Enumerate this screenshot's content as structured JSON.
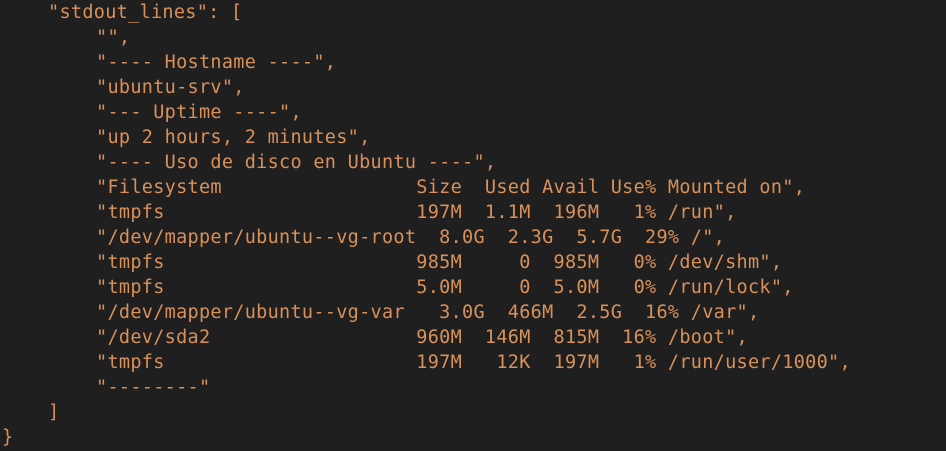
{
  "terminal": {
    "key_line": "\"stdout_lines\": [",
    "lines": [
      "\"\",",
      "\"---- Hostname ----\",",
      "\"ubuntu-srv\",",
      "\"--- Uptime ----\",",
      "\"up 2 hours, 2 minutes\",",
      "\"---- Uso de disco en Ubuntu ----\",",
      "\"Filesystem                 Size  Used Avail Use% Mounted on\",",
      "\"tmpfs                      197M  1.1M  196M   1% /run\",",
      "\"/dev/mapper/ubuntu--vg-root  8.0G  2.3G  5.7G  29% /\",",
      "\"tmpfs                      985M     0  985M   0% /dev/shm\",",
      "\"tmpfs                      5.0M     0  5.0M   0% /run/lock\",",
      "\"/dev/mapper/ubuntu--vg-var   3.0G  466M  2.5G  16% /var\",",
      "\"/dev/sda2                  960M  146M  815M  16% /boot\",",
      "\"tmpfs                      197M   12K  197M   1% /run/user/1000\",",
      "\"--------\""
    ],
    "close_bracket": "]",
    "close_brace": "}"
  },
  "colors": {
    "background": "#1f1f1f",
    "text": "#d9915a"
  }
}
